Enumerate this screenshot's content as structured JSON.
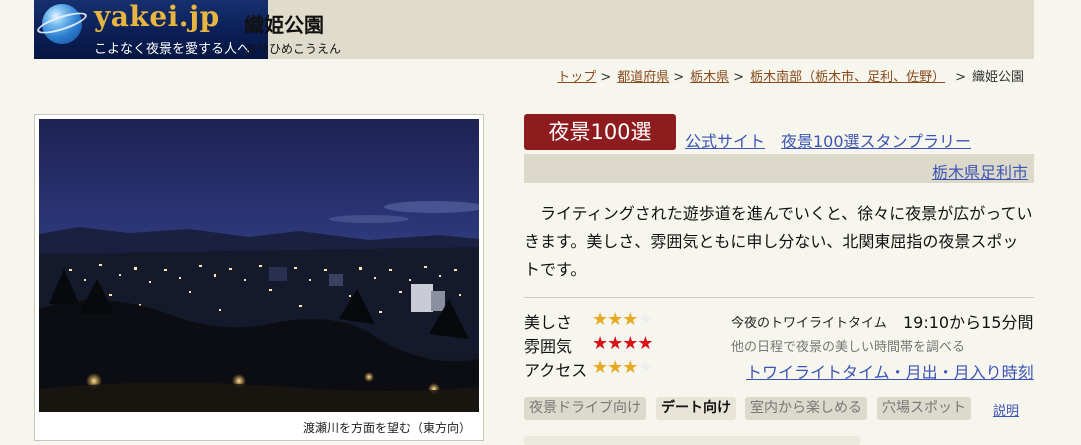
{
  "header": {
    "logo_text": "yakei.jp",
    "logo_tagline": "こよなく夜景を愛する人へ",
    "title": "織姫公園",
    "title_kana": "おりひめこうえん"
  },
  "breadcrumb": {
    "items": [
      "トップ",
      "都道府県",
      "栃木県",
      "栃木南部（栃木市、足利、佐野）"
    ],
    "separator": ">",
    "current": "織姫公園"
  },
  "photo": {
    "caption": "渡瀬川を方面を望む（東方向）"
  },
  "badge": "夜景100選",
  "links": {
    "official_site": "公式サイト",
    "stamp_rally": "夜景100選スタンプラリー",
    "location": "栃木県足利市"
  },
  "description": "ライティングされた遊歩道を進んでいくと、徐々に夜景が広がっていきます。美しさ、雰囲気ともに申し分ない、北関東屈指の夜景スポットです。",
  "ratings": [
    {
      "label": "美しさ",
      "value": 3,
      "max": 4,
      "color": "#e7a823"
    },
    {
      "label": "雰囲気",
      "value": 4,
      "max": 4,
      "color": "#d8121a"
    },
    {
      "label": "アクセス",
      "value": 3,
      "max": 4,
      "color": "#e7a823"
    }
  ],
  "twilight": {
    "label": "今夜のトワイライトタイム",
    "value": "19:10から15分間",
    "note": "他の日程で夜景の美しい時間帯を調べる",
    "link": "トワイライトタイム・月出・月入り時刻"
  },
  "tags": [
    {
      "label": "夜景ドライブ向け",
      "active": false
    },
    {
      "label": "デート向け",
      "active": true
    },
    {
      "label": "室内から楽しめる",
      "active": false
    },
    {
      "label": "穴場スポット",
      "active": false
    }
  ],
  "explain_link": "説明",
  "colors": {
    "badge": "#8e1b1d",
    "link": "#3c55b4",
    "breadcrumb_link": "#8a4a1c",
    "header_bg": "#e0dccb",
    "page_bg": "#f7f6ee"
  }
}
